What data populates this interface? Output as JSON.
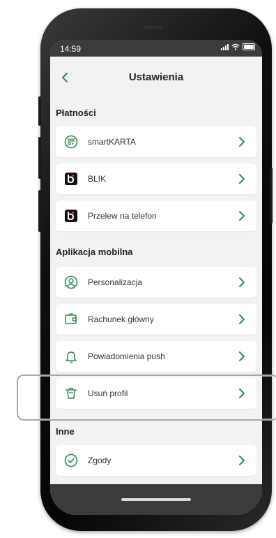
{
  "status_bar": {
    "time": "14:59"
  },
  "header": {
    "title": "Ustawienia"
  },
  "sections": [
    {
      "title": "Płatności",
      "items": [
        {
          "label": "smartKARTA",
          "icon": "qr-card-icon"
        },
        {
          "label": "BLIK",
          "icon": "blik-icon"
        },
        {
          "label": "Przelew na telefon",
          "icon": "blik-phone-transfer-icon"
        }
      ]
    },
    {
      "title": "Aplikacja mobilna",
      "items": [
        {
          "label": "Personalizacja",
          "icon": "user-circle-icon"
        },
        {
          "label": "Rachunek główny",
          "icon": "wallet-icon"
        },
        {
          "label": "Powiadomienia push",
          "icon": "bell-icon"
        },
        {
          "label": "Usuń profil",
          "icon": "trash-icon"
        }
      ]
    },
    {
      "title": "Inne",
      "items": [
        {
          "label": "Zgody",
          "icon": "check-circle-icon"
        }
      ]
    }
  ],
  "colors": {
    "accent_green": "#2e8b57",
    "status_bar": "#3b3b3b",
    "background": "#f2f2f2",
    "blik_black": "#111111",
    "blik_red": "#e8232a"
  }
}
